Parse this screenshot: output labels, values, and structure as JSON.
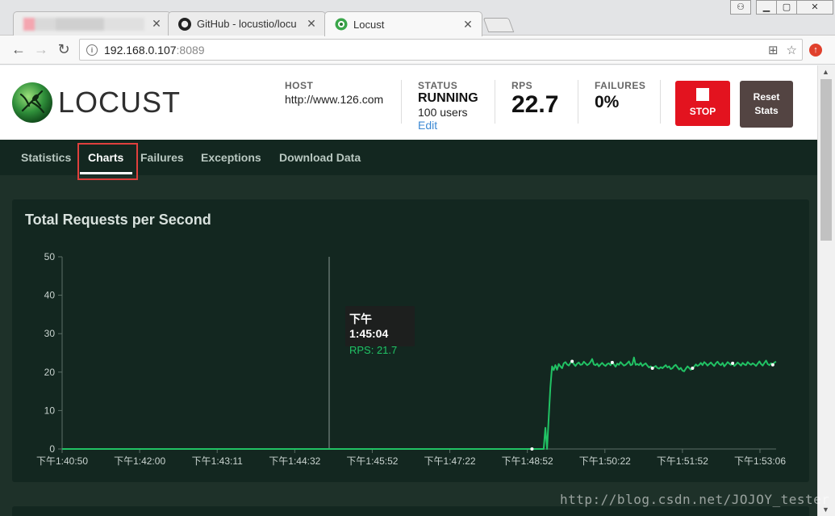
{
  "browser": {
    "tabs": [
      {
        "title": "",
        "blurred": true
      },
      {
        "title": "GitHub - locustio/locu"
      },
      {
        "title": "Locust",
        "active": true
      }
    ],
    "url_host": "192.168.0.107",
    "url_port": ":8089"
  },
  "header": {
    "logo_text": "LOCUST",
    "host_label": "HOST",
    "host_value": "http://www.126.com",
    "status_label": "STATUS",
    "status_value": "RUNNING",
    "users_value": "100 users",
    "edit_label": "Edit",
    "rps_label": "RPS",
    "rps_value": "22.7",
    "failures_label": "FAILURES",
    "failures_value": "0%",
    "stop_label": "STOP",
    "reset_label_1": "Reset",
    "reset_label_2": "Stats"
  },
  "nav": {
    "items": [
      "Statistics",
      "Charts",
      "Failures",
      "Exceptions",
      "Download Data"
    ],
    "active": "Charts"
  },
  "panel": {
    "title": "Total Requests per Second"
  },
  "tooltip": {
    "time": "下午1:45:04",
    "value": "RPS: 21.7"
  },
  "watermark": "http://blog.csdn.net/JOJOY_tester",
  "colors": {
    "line": "#21c264",
    "background": "#1e3129",
    "panel": "#132720",
    "stop": "#e3131f",
    "reset": "#534442"
  },
  "chart_data": {
    "type": "line",
    "title": "Total Requests per Second",
    "ylim": [
      0,
      50
    ],
    "yticks": [
      0,
      10,
      20,
      30,
      40,
      50
    ],
    "xtick_labels": [
      "下午1:40:50",
      "下午1:42:00",
      "下午1:43:11",
      "下午1:44:32",
      "下午1:45:52",
      "下午1:47:22",
      "下午1:48:52",
      "下午1:50:22",
      "下午1:51:52",
      "下午1:53:06"
    ],
    "series": [
      {
        "values": [
          0,
          0,
          0,
          0,
          0,
          0,
          0,
          0,
          0,
          0,
          0,
          0,
          0,
          0,
          0,
          0,
          0,
          0,
          0,
          0,
          0,
          0,
          0,
          0,
          0,
          0,
          0,
          0,
          0,
          0,
          0,
          0,
          0,
          0,
          0,
          0,
          0,
          0,
          0,
          0,
          0,
          0,
          0,
          0,
          0,
          0,
          0,
          0,
          0,
          0,
          0,
          0,
          0,
          0,
          0,
          0,
          0,
          0,
          0,
          0,
          0,
          0,
          0,
          0,
          0,
          0,
          0,
          0,
          0,
          0,
          0,
          0,
          0,
          0,
          0,
          0,
          0,
          0,
          0,
          0,
          0,
          0,
          0,
          0,
          0,
          0,
          0,
          0,
          0,
          0,
          0,
          0,
          0,
          0,
          0,
          0,
          0,
          0,
          0,
          0,
          0,
          0,
          0,
          0,
          0,
          0,
          0,
          0,
          0,
          0,
          0,
          0,
          0,
          0,
          0,
          0,
          0,
          0,
          0,
          0,
          0,
          0,
          0,
          0,
          0,
          0,
          0,
          0,
          0,
          0,
          0,
          0,
          0,
          0,
          0,
          0,
          0,
          0,
          0,
          0,
          0,
          0,
          0,
          0,
          0,
          0,
          0,
          0,
          0,
          0,
          0,
          0,
          0,
          0,
          0,
          0,
          0,
          0,
          0,
          0,
          0,
          0,
          0,
          0,
          0,
          0,
          0,
          0,
          0,
          0,
          0,
          0,
          0,
          0,
          0,
          0,
          0,
          0,
          0,
          0,
          0,
          0,
          0,
          0,
          0,
          0,
          0,
          0,
          0,
          0,
          0,
          0,
          0,
          0,
          0,
          0,
          0,
          0,
          0,
          0,
          0,
          0,
          0,
          0,
          0,
          0,
          0,
          0,
          0,
          0,
          0,
          0,
          0,
          0,
          0,
          0,
          0,
          0,
          0,
          0,
          0,
          0,
          0,
          0,
          0,
          0,
          0,
          0,
          0,
          0,
          0,
          0,
          0,
          0,
          0,
          0,
          0,
          0,
          0,
          0,
          0,
          0,
          0,
          0,
          0,
          0,
          0,
          0,
          0,
          0,
          0,
          0,
          0,
          0,
          0,
          0,
          0,
          0,
          0,
          0,
          0,
          0,
          0,
          0,
          0,
          0,
          0,
          0,
          0,
          0,
          0,
          0,
          0,
          0,
          0,
          0,
          0,
          0,
          0,
          0,
          0,
          0,
          0,
          0,
          0,
          0,
          0,
          0,
          0,
          5.5,
          0,
          8,
          16,
          21.5,
          20.5,
          21.8,
          20.6,
          22.1,
          21.5,
          21.0,
          22.3,
          22.6,
          22.0,
          21.7,
          22.4,
          22.8,
          22.1,
          21.6,
          22.2,
          22.5,
          21.9,
          22.0,
          22.7,
          22.3,
          21.8,
          22.1,
          22.6,
          23.4,
          22.0,
          21.8,
          22.2,
          21.5,
          22.0,
          22.4,
          21.9,
          21.6,
          22.1,
          22.3,
          21.8,
          22.5,
          22.0,
          21.4,
          22.2,
          21.9,
          22.6,
          22.1,
          21.7,
          21.9,
          22.3,
          22.8,
          21.8,
          22.0,
          23.8,
          21.9,
          22.1,
          21.8,
          22.4,
          21.6,
          22.0,
          22.3,
          21.7,
          21.2,
          21.5,
          21.0,
          21.3,
          21.6,
          21.1,
          20.9,
          21.3,
          21.0,
          21.4,
          21.8,
          21.2,
          21.5,
          20.8,
          21.0,
          21.6,
          21.9,
          21.3,
          20.7,
          21.1,
          20.4,
          20.2,
          20.9,
          21.5,
          21.1,
          20.6,
          21.0,
          21.4,
          22.0,
          21.6,
          21.9,
          22.4,
          21.8,
          22.6,
          22.2,
          21.7,
          22.1,
          22.5,
          22.0,
          21.6,
          22.3,
          22.7,
          22.1,
          21.8,
          22.4,
          21.5,
          22.0,
          22.6,
          22.2,
          21.9,
          22.3,
          21.6,
          22.0,
          22.5,
          22.1,
          21.7,
          22.4,
          22.0,
          21.8,
          22.6,
          22.2,
          21.9,
          22.3,
          22.0,
          21.6,
          22.2,
          22.8,
          22.1,
          21.7,
          22.4,
          23.0,
          22.1,
          21.8,
          22.3,
          21.9,
          22.5,
          22.7
        ]
      }
    ],
    "grid": false
  }
}
